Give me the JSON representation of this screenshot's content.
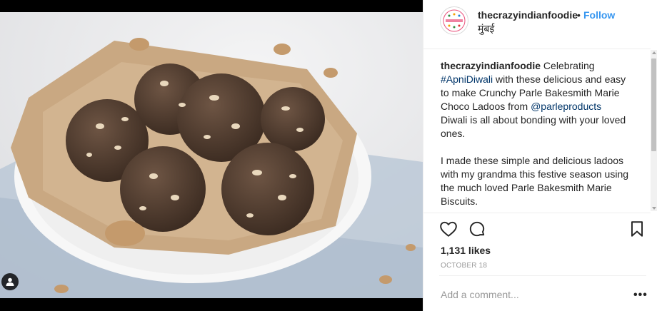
{
  "post": {
    "username": "thecrazyindianfoodie",
    "separator": "•",
    "follow_label": "Follow",
    "location": "मुंबई",
    "caption": {
      "username": "thecrazyindianfoodie",
      "text_1": " Celebrating ",
      "hashtag": "#ApniDiwali",
      "text_2": " with these delicious and easy to make Crunchy Parle Bakesmith Marie Choco Ladoos from ",
      "mention": "@parleproducts",
      "text_3": "\nDiwali is all about bonding with your loved ones.\n\nI made these simple and delicious ladoos with my grandma this festive season using the much loved Parle Bakesmith Marie Biscuits."
    },
    "likes": "1,131 likes",
    "date": "OCTOBER 18",
    "comment_placeholder": "Add a comment...",
    "more_label": "•••"
  },
  "icons": [
    "heart-icon",
    "comment-icon",
    "bookmark-icon",
    "user-tag-icon",
    "more-options-icon"
  ],
  "colors": {
    "follow": "#3897f0",
    "link": "#003569",
    "text": "#262626",
    "muted": "#999999"
  }
}
